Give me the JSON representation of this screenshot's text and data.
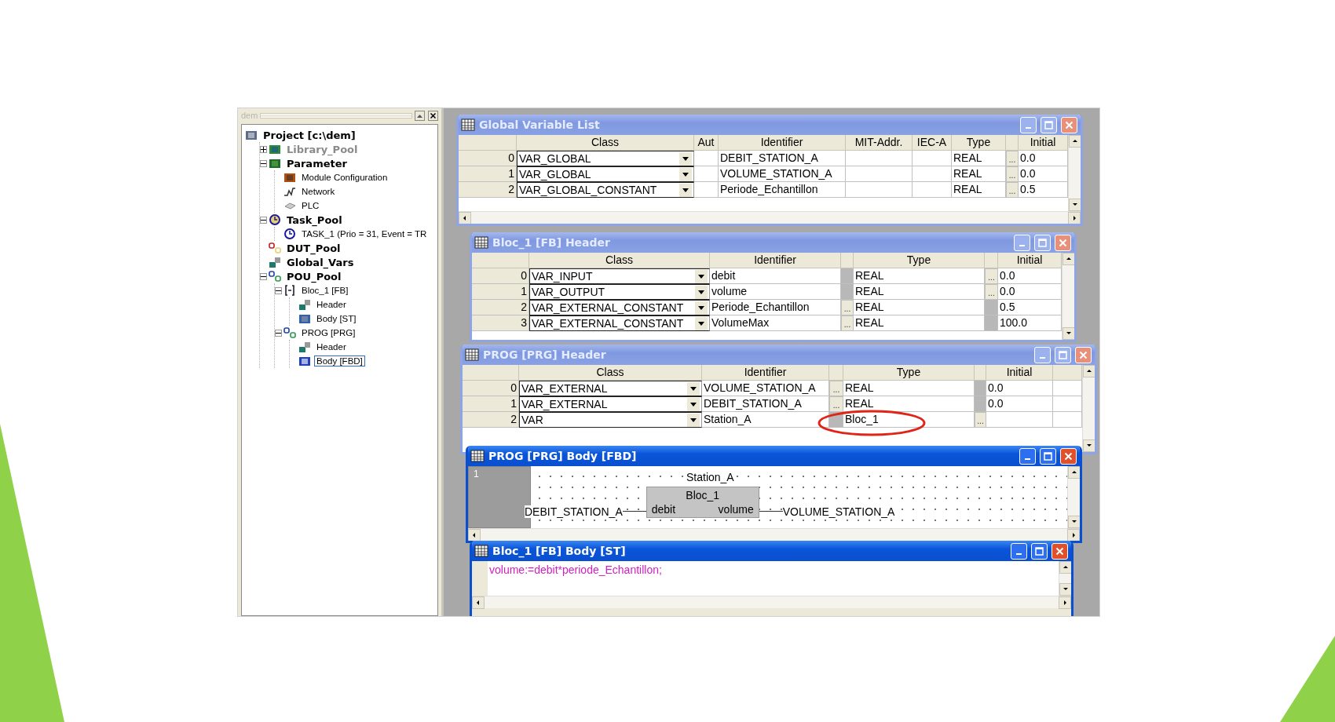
{
  "project_panel": {
    "title": "dem",
    "tree": [
      {
        "label": "Project [c:\\dem]",
        "kind": "project",
        "selected": false,
        "disabled": false,
        "children": [
          {
            "label": "Library_Pool",
            "kind": "library",
            "expanded": false,
            "selected": false,
            "disabled": true
          },
          {
            "label": "Parameter",
            "kind": "parameter",
            "expanded": true,
            "selected": false,
            "disabled": false,
            "children": [
              {
                "label": "Module Configuration",
                "kind": "module",
                "selected": false,
                "disabled": false
              },
              {
                "label": "Network",
                "kind": "network",
                "selected": false,
                "disabled": false
              },
              {
                "label": "PLC",
                "kind": "plc",
                "selected": false,
                "disabled": false
              }
            ]
          },
          {
            "label": "Task_Pool",
            "kind": "taskpool",
            "expanded": true,
            "selected": false,
            "disabled": false,
            "children": [
              {
                "label": "TASK_1 (Prio = 31, Event = TR",
                "kind": "task",
                "selected": false,
                "disabled": false
              }
            ]
          },
          {
            "label": "DUT_Pool",
            "kind": "dut",
            "selected": false,
            "disabled": false
          },
          {
            "label": "Global_Vars",
            "kind": "header",
            "selected": false,
            "disabled": false
          },
          {
            "label": "POU_Pool",
            "kind": "pou",
            "expanded": true,
            "selected": false,
            "disabled": false,
            "children": [
              {
                "label": "Bloc_1 [FB]",
                "kind": "fb",
                "expanded": true,
                "selected": false,
                "disabled": false,
                "children": [
                  {
                    "label": "Header",
                    "kind": "header",
                    "selected": false,
                    "disabled": false
                  },
                  {
                    "label": "Body [ST]",
                    "kind": "st",
                    "selected": false,
                    "disabled": false
                  }
                ]
              },
              {
                "label": "PROG [PRG]",
                "kind": "pou",
                "expanded": true,
                "selected": false,
                "disabled": false,
                "children": [
                  {
                    "label": "Header",
                    "kind": "header",
                    "selected": false,
                    "disabled": false
                  },
                  {
                    "label": "Body [FBD]",
                    "kind": "fbd",
                    "selected": true,
                    "disabled": false
                  }
                ]
              }
            ]
          }
        ]
      }
    ]
  },
  "windows": [
    {
      "title": "Global Variable List",
      "kind": "table",
      "active": false,
      "columns": [
        {
          "kind": "index"
        },
        {
          "kind": "combo",
          "heading": "Class"
        },
        {
          "kind": "text",
          "heading": "Aut"
        },
        {
          "kind": "text",
          "heading": "Identifier"
        },
        {
          "kind": "text",
          "heading": "MIT-Addr."
        },
        {
          "kind": "text",
          "heading": "IEC-A"
        },
        {
          "kind": "text",
          "heading": "Type"
        },
        {
          "kind": "button"
        },
        {
          "kind": "text",
          "heading": "Initial"
        }
      ],
      "rows": [
        {
          "cells": [
            "0",
            "VAR_GLOBAL",
            null,
            "DEBIT_STATION_A",
            null,
            null,
            "REAL",
            "...",
            "0.0"
          ]
        },
        {
          "cells": [
            "1",
            "VAR_GLOBAL",
            null,
            "VOLUME_STATION_A",
            null,
            null,
            "REAL",
            "...",
            "0.0"
          ]
        },
        {
          "cells": [
            "2",
            "VAR_GLOBAL_CONSTANT",
            null,
            "Periode_Echantillon",
            null,
            null,
            "REAL",
            "...",
            "0.5"
          ]
        }
      ]
    },
    {
      "title": "Bloc_1 [FB] Header",
      "kind": "table",
      "active": false,
      "columns": [
        {
          "kind": "index"
        },
        {
          "kind": "combo",
          "heading": "Class"
        },
        {
          "kind": "text",
          "heading": "Identifier"
        },
        {
          "kind": "button"
        },
        {
          "kind": "text",
          "heading": "Type"
        },
        {
          "kind": "button"
        },
        {
          "kind": "text",
          "heading": "Initial"
        }
      ],
      "rows": [
        {
          "cells": [
            "0",
            "VAR_INPUT",
            "debit",
            false,
            "REAL",
            "...",
            "0.0"
          ]
        },
        {
          "cells": [
            "1",
            "VAR_OUTPUT",
            "volume",
            false,
            "REAL",
            "...",
            "0.0"
          ]
        },
        {
          "cells": [
            "2",
            "VAR_EXTERNAL_CONSTANT",
            "Periode_Echantillon",
            "...",
            "REAL",
            false,
            "0.5"
          ]
        },
        {
          "cells": [
            "3",
            "VAR_EXTERNAL_CONSTANT",
            "VolumeMax",
            "...",
            "REAL",
            false,
            "100.0"
          ]
        }
      ]
    },
    {
      "title": "PROG [PRG] Header",
      "kind": "table",
      "active": false,
      "columns": [
        {
          "kind": "index"
        },
        {
          "kind": "combo",
          "heading": "Class"
        },
        {
          "kind": "text",
          "heading": "Identifier"
        },
        {
          "kind": "button"
        },
        {
          "kind": "text",
          "heading": "Type"
        },
        {
          "kind": "button"
        },
        {
          "kind": "text",
          "heading": "Initial"
        },
        {
          "kind": "text"
        }
      ],
      "rows": [
        {
          "cells": [
            "0",
            "VAR_EXTERNAL",
            "VOLUME_STATION_A",
            "...",
            "REAL",
            false,
            "0.0",
            null
          ]
        },
        {
          "cells": [
            "1",
            "VAR_EXTERNAL",
            "DEBIT_STATION_A",
            "...",
            "REAL",
            false,
            "0.0",
            null
          ]
        },
        {
          "cells": [
            "2",
            "VAR",
            "Station_A",
            false,
            {
              "text": "Bloc_1",
              "circled": true
            },
            "...",
            null,
            null
          ]
        }
      ]
    },
    {
      "title": "PROG [PRG] Body [FBD]",
      "kind": "fbd",
      "active": true,
      "network": "1",
      "instance": "Station_A",
      "block": {
        "type": "Bloc_1",
        "input": "debit",
        "output": "volume"
      },
      "input_var": "DEBIT_STATION_A",
      "output_var": "VOLUME_STATION_A"
    },
    {
      "title": "Bloc_1 [FB] Body [ST]",
      "kind": "st",
      "active": true,
      "code": "volume:=debit*periode_Echantillon;"
    }
  ]
}
